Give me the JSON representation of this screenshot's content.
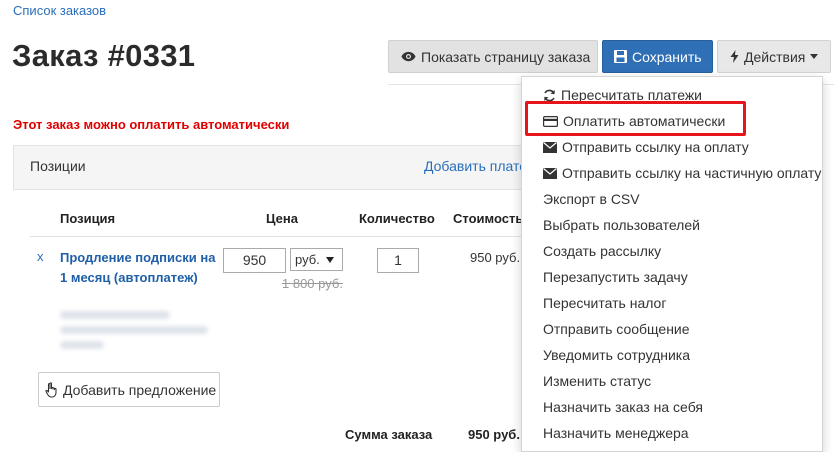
{
  "breadcrumb": {
    "label": "Список заказов"
  },
  "page": {
    "title": "Заказ #0331",
    "auto_pay_note": "Этот заказ можно оплатить автоматически"
  },
  "toolbar": {
    "show_page_label": "Показать страницу заказа",
    "save_label": "Сохранить",
    "actions_label": "Действия"
  },
  "positions": {
    "title": "Позиции",
    "add_payment_label": "Добавить плате",
    "columns": [
      "Позиция",
      "Цена",
      "Количество",
      "Стоимость"
    ],
    "items": [
      {
        "remove": "x",
        "name": "Продление подписки на 1 месяц (автоплатеж)",
        "price": "950",
        "currency": "руб.",
        "old_price": "1 800 руб.",
        "quantity": "1",
        "total": "950 руб."
      }
    ],
    "add_offer_label": "Добавить предложение",
    "sum_label": "Сумма заказа",
    "sum_value": "950 руб."
  },
  "actions_menu": {
    "items": [
      {
        "label": "Пересчитать платежи",
        "icon": "refresh-icon"
      },
      {
        "label": "Оплатить автоматически",
        "icon": "credit-card-icon",
        "highlighted": true
      },
      {
        "label": "Отправить ссылку на оплату",
        "icon": "envelope-icon"
      },
      {
        "label": "Отправить ссылку на частичную оплату",
        "icon": "envelope-icon"
      },
      {
        "label": "Экспорт в CSV"
      },
      {
        "label": "Выбрать пользователей"
      },
      {
        "label": "Создать рассылку"
      },
      {
        "label": "Перезапустить задачу"
      },
      {
        "label": "Пересчитать налог"
      },
      {
        "label": "Отправить сообщение"
      },
      {
        "label": "Уведомить сотрудника"
      },
      {
        "label": "Изменить статус"
      },
      {
        "label": "Назначить заказ на себя"
      },
      {
        "label": "Назначить менеджера"
      }
    ]
  },
  "colors": {
    "primary": "#2f6fb5",
    "link": "#2a6ebb",
    "alert": "#e00000",
    "highlight": "#e8141b"
  }
}
